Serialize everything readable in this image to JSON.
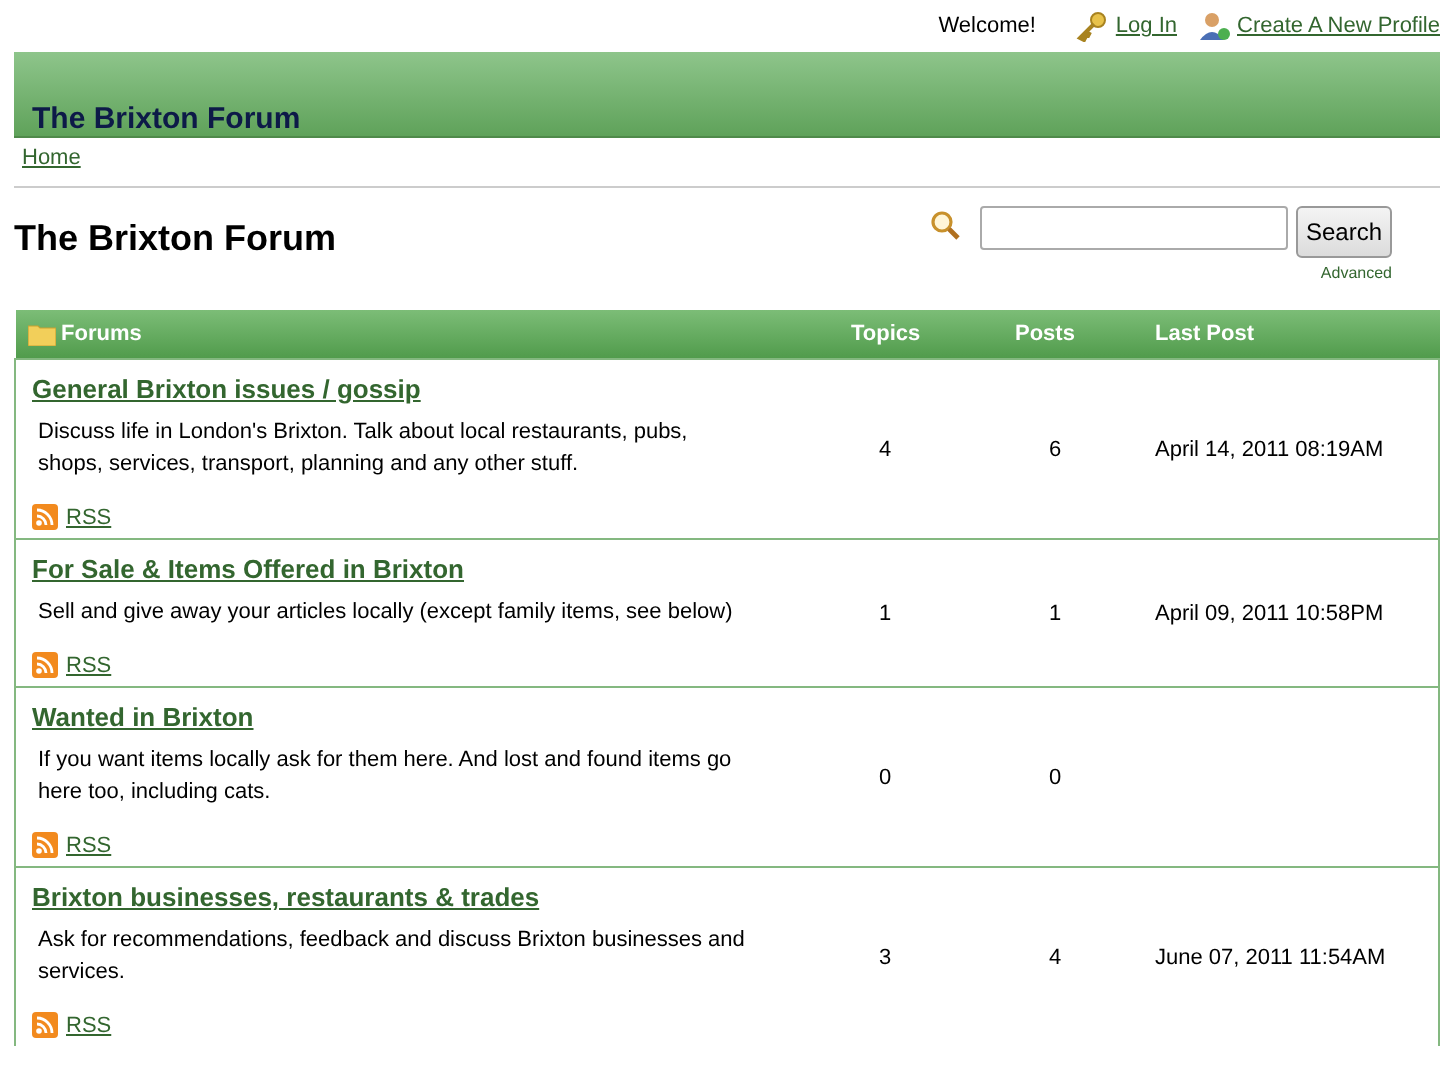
{
  "top_bar": {
    "welcome": "Welcome!",
    "login": "Log In",
    "create_profile": "Create A New Profile"
  },
  "banner": {
    "title": "The Brixton Forum"
  },
  "breadcrumb": [
    "Home"
  ],
  "page_title": "The Brixton Forum",
  "search": {
    "button": "Search",
    "advanced": "Advanced"
  },
  "table": {
    "columns": [
      "Forums",
      "Topics",
      "Posts",
      "Last Post"
    ],
    "rows": [
      {
        "title": "General Brixton issues / gossip",
        "description": "Discuss life in London's Brixton. Talk about local restaurants, pubs, shops, services, transport, planning and any other stuff.",
        "rss": "RSS",
        "topics": "4",
        "posts": "6",
        "last_post": "April 14, 2011 08:19AM"
      },
      {
        "title": "For Sale & Items Offered in Brixton",
        "description": "Sell and give away your articles locally (except family items, see below)",
        "rss": "RSS",
        "topics": "1",
        "posts": "1",
        "last_post": "April 09, 2011 10:58PM"
      },
      {
        "title": "Wanted in Brixton",
        "description": "If you want items locally ask for them here. And lost and found items go here too, including cats.",
        "rss": "RSS",
        "topics": "0",
        "posts": "0"
      },
      {
        "title": "Brixton businesses, restaurants & trades",
        "description": "Ask for recommendations, feedback and discuss Brixton businesses and services.",
        "rss": "RSS",
        "topics": "3",
        "posts": "4",
        "last_post": "June 07, 2011 11:54AM"
      }
    ]
  }
}
